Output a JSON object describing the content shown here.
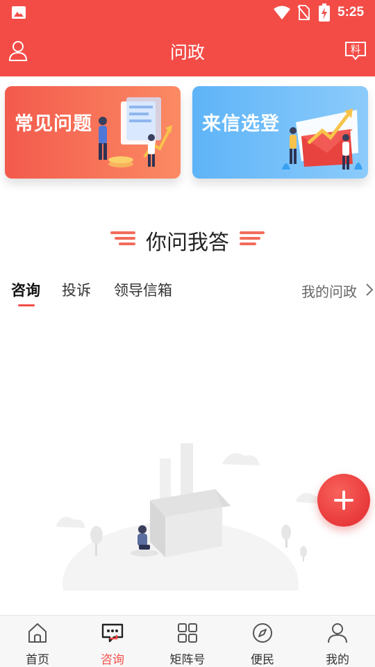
{
  "status_bar": {
    "time": "5:25"
  },
  "header": {
    "title": "问政",
    "tip_label": "料"
  },
  "cards": [
    {
      "title": "常见问题"
    },
    {
      "title": "来信选登"
    }
  ],
  "section": {
    "heading": "你问我答"
  },
  "tabs": [
    {
      "label": "咨询",
      "active": true
    },
    {
      "label": "投诉",
      "active": false
    },
    {
      "label": "领导信箱",
      "active": false
    }
  ],
  "my_link": {
    "label": "我的问政"
  },
  "bottom_nav": [
    {
      "label": "首页",
      "icon": "home-icon",
      "active": false
    },
    {
      "label": "咨询",
      "icon": "chat-icon",
      "active": true
    },
    {
      "label": "矩阵号",
      "icon": "grid-icon",
      "active": false
    },
    {
      "label": "便民",
      "icon": "compass-icon",
      "active": false
    },
    {
      "label": "我的",
      "icon": "person-icon",
      "active": false
    }
  ],
  "colors": {
    "brand": "#f34c47",
    "faq_card": "#f35a4c",
    "letter_card": "#5eb4f8"
  }
}
